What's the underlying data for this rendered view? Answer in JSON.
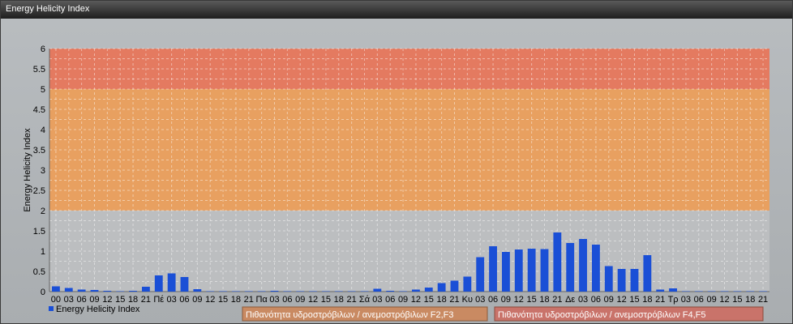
{
  "window_title": "Energy Helicity Index",
  "chart_data": {
    "type": "bar",
    "ylabel": "Energy Helicity Index",
    "ylim": [
      0,
      6
    ],
    "yticks": [
      "0",
      "0.5",
      "1",
      "1.5",
      "2",
      "2.5",
      "3",
      "3.5",
      "4",
      "4.5",
      "5",
      "5.5",
      "6"
    ],
    "grid": true,
    "categories": [
      "00",
      "03",
      "06",
      "09",
      "12",
      "15",
      "18",
      "21",
      "Πέ",
      "03",
      "06",
      "09",
      "12",
      "15",
      "18",
      "21",
      "Πα",
      "03",
      "06",
      "09",
      "12",
      "15",
      "18",
      "21",
      "Σά",
      "03",
      "06",
      "09",
      "12",
      "15",
      "18",
      "21",
      "Κυ",
      "03",
      "06",
      "09",
      "12",
      "15",
      "18",
      "21",
      "Δε",
      "03",
      "06",
      "09",
      "12",
      "15",
      "18",
      "21",
      "Τρ",
      "03",
      "06",
      "09",
      "12",
      "15",
      "18",
      "21"
    ],
    "series": [
      {
        "name": "Energy Helicity Index",
        "color": "#1a4fd6",
        "values": [
          0.13,
          0.09,
          0.05,
          0.04,
          0.02,
          0.01,
          0.02,
          0.12,
          0.4,
          0.45,
          0.36,
          0.06,
          0.01,
          0.01,
          0.01,
          0.01,
          0.01,
          0.02,
          0.01,
          0.01,
          0.01,
          0.01,
          0.01,
          0.01,
          0.01,
          0.07,
          0.02,
          0.01,
          0.05,
          0.1,
          0.21,
          0.27,
          0.37,
          0.85,
          1.12,
          0.98,
          1.04,
          1.06,
          1.05,
          1.46,
          1.2,
          1.3,
          1.16,
          0.63,
          0.56,
          0.56,
          0.9,
          0.05,
          0.08,
          0.01,
          0.01,
          0.01,
          0.01,
          0.01,
          0.01,
          0.01
        ]
      }
    ],
    "bands": [
      {
        "from": 2,
        "to": 5,
        "color": "#e8a060",
        "label": "Πιθανότητα υδροστρόβιλων / ανεμοστρόβιλων F2,F3"
      },
      {
        "from": 5,
        "to": 6,
        "color": "#e47a60",
        "label": "Πιθανότητα υδροστρόβιλων / ανεμοστρόβιλων F4,F5"
      }
    ],
    "legend_position": "bottom-left"
  }
}
